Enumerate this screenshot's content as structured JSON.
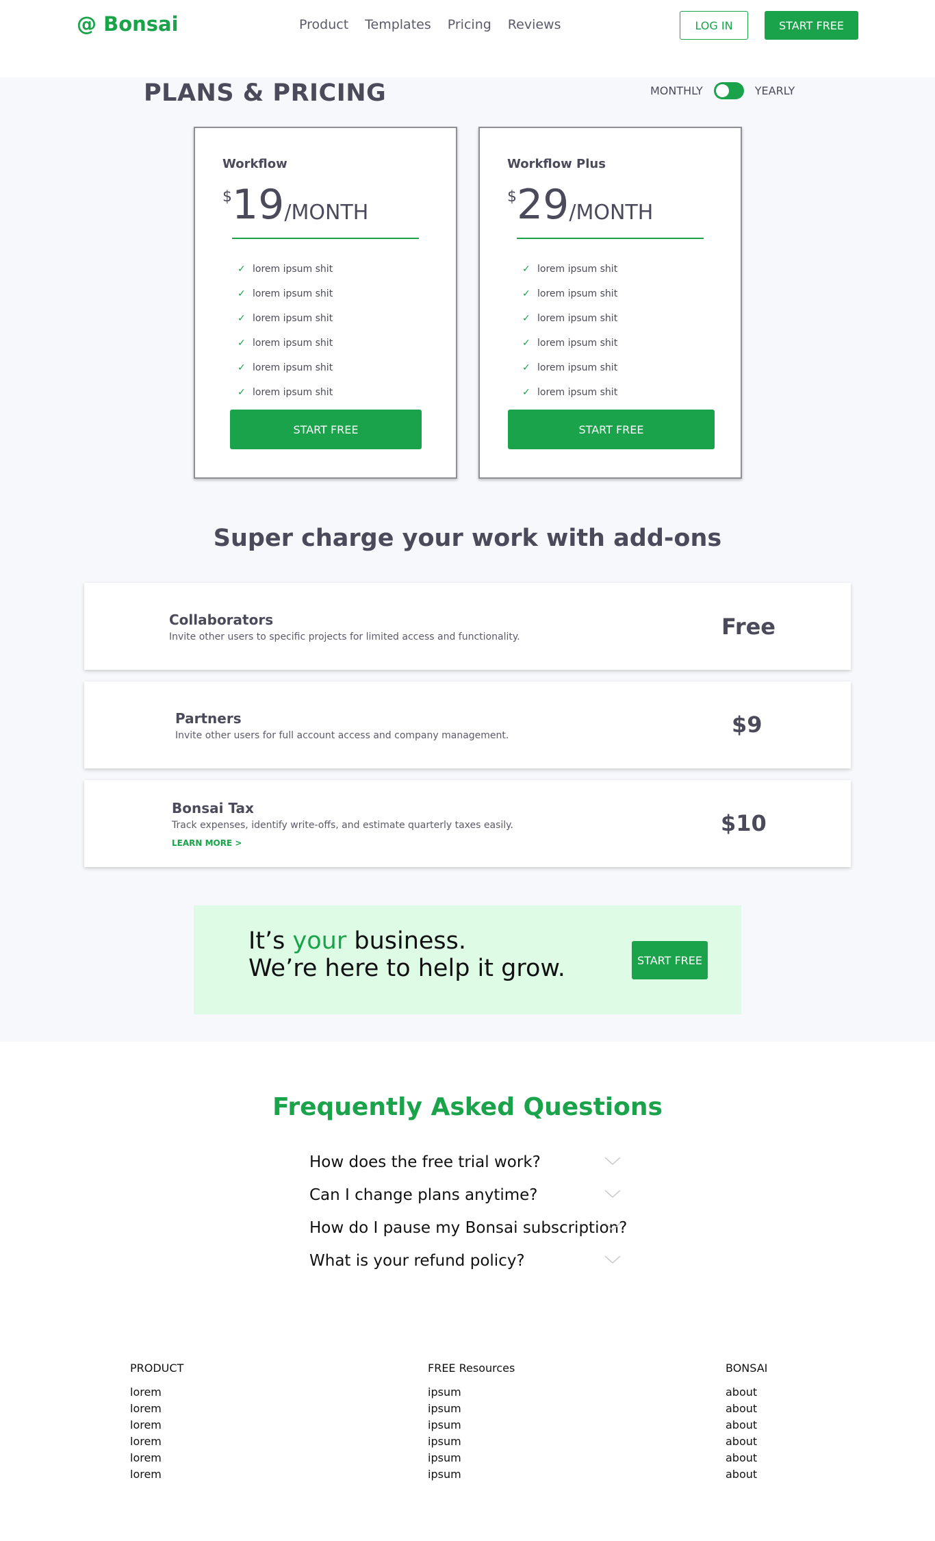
{
  "header": {
    "logo": "@ Bonsai",
    "nav": [
      "Product",
      "Templates",
      "Pricing",
      "Reviews"
    ],
    "login_label": "LOG IN",
    "start_label": "START FREE"
  },
  "pricing": {
    "title": "PLANS & PRICING",
    "toggle_monthly": "MONTHLY",
    "toggle_yearly": "YEARLY",
    "plans": [
      {
        "name": "Workflow",
        "currency": "$",
        "amount": "19",
        "unit": "/MONTH",
        "features": [
          "lorem ipsum shit",
          "lorem ipsum shit",
          "lorem ipsum shit",
          "lorem ipsum shit",
          "lorem ipsum shit",
          "lorem ipsum shit"
        ],
        "button": "START FREE"
      },
      {
        "name": "Workflow Plus",
        "currency": "$",
        "amount": "29",
        "unit": "/MONTH",
        "features": [
          "lorem ipsum shit",
          "lorem ipsum shit",
          "lorem ipsum shit",
          "lorem ipsum shit",
          "lorem ipsum shit",
          "lorem ipsum shit"
        ],
        "button": "START FREE"
      }
    ]
  },
  "addons": {
    "title": "Super charge your work with add-ons",
    "items": [
      {
        "name": "Collaborators",
        "desc": "Invite other users to specific projects for limited access and functionality.",
        "price": "Free"
      },
      {
        "name": "Partners",
        "desc": "Invite other users for full account access and company management.",
        "price": "$9"
      },
      {
        "name": "Bonsai Tax",
        "desc": "Track expenses, identify write-offs, and estimate quarterly taxes easily.",
        "link": "LEARN MORE >",
        "price": "$10"
      }
    ]
  },
  "cta": {
    "line1_pre": "It’s ",
    "line1_accent": "your",
    "line1_post": " business.",
    "line2": "We’re here to help it grow.",
    "button": "START FREE"
  },
  "faq": {
    "title": "Frequently Asked Questions",
    "items": [
      "How does the free trial work?",
      "Can I change plans anytime?",
      "How do I pause my Bonsai subscription?",
      "What is your refund policy?"
    ]
  },
  "footer": {
    "columns": [
      {
        "title": "PRODUCT",
        "links": [
          "lorem",
          "lorem",
          "lorem",
          "lorem",
          "lorem",
          "lorem"
        ]
      },
      {
        "title": "FREE Resources",
        "links": [
          "ipsum",
          "ipsum",
          "ipsum",
          "ipsum",
          "ipsum",
          "ipsum"
        ]
      },
      {
        "title": "BONSAI",
        "links": [
          "about",
          "about",
          "about",
          "about",
          "about",
          "about"
        ]
      }
    ]
  },
  "colors": {
    "brand_green": "#1aa34a",
    "cta_background": "#defbe6",
    "section_background": "#f7f8fb"
  }
}
